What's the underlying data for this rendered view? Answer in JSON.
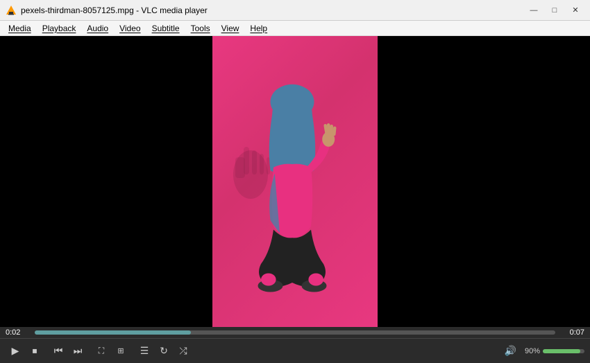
{
  "window": {
    "title": "pexels-thirdman-8057125.mpg - VLC media player",
    "icon": "🎦"
  },
  "controls": {
    "minimize": "—",
    "maximize": "□",
    "close": "✕"
  },
  "menu": {
    "items": [
      "Media",
      "Playback",
      "Audio",
      "Video",
      "Subtitle",
      "Tools",
      "View",
      "Help"
    ]
  },
  "progress": {
    "time_left": "0:02",
    "time_right": "0:07"
  },
  "playback_controls": [
    {
      "name": "play",
      "symbol": "▶"
    },
    {
      "name": "stop",
      "symbol": "⏹"
    },
    {
      "name": "prev",
      "symbol": "⏮"
    },
    {
      "name": "next",
      "symbol": "⏭"
    },
    {
      "name": "fullscreen",
      "symbol": "⛶"
    },
    {
      "name": "extended",
      "symbol": "⧈"
    },
    {
      "name": "playlist",
      "symbol": "☰"
    },
    {
      "name": "loop",
      "symbol": "↻"
    },
    {
      "name": "random",
      "symbol": "⤮"
    }
  ],
  "volume": {
    "label": "90%",
    "icon": "🔊",
    "percent": 90
  }
}
